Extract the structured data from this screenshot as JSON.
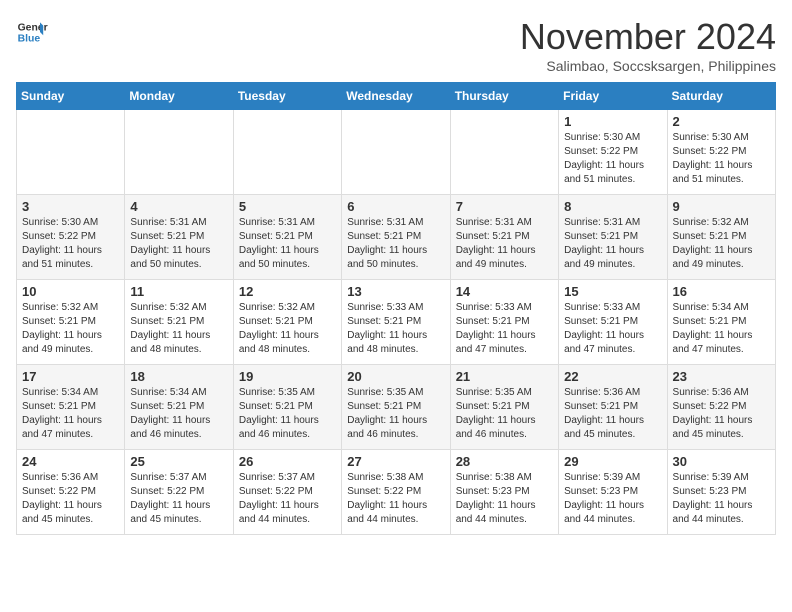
{
  "logo": {
    "line1": "General",
    "line2": "Blue"
  },
  "title": "November 2024",
  "subtitle": "Salimbao, Soccsksargen, Philippines",
  "weekdays": [
    "Sunday",
    "Monday",
    "Tuesday",
    "Wednesday",
    "Thursday",
    "Friday",
    "Saturday"
  ],
  "weeks": [
    [
      {
        "day": "",
        "info": ""
      },
      {
        "day": "",
        "info": ""
      },
      {
        "day": "",
        "info": ""
      },
      {
        "day": "",
        "info": ""
      },
      {
        "day": "",
        "info": ""
      },
      {
        "day": "1",
        "info": "Sunrise: 5:30 AM\nSunset: 5:22 PM\nDaylight: 11 hours and 51 minutes."
      },
      {
        "day": "2",
        "info": "Sunrise: 5:30 AM\nSunset: 5:22 PM\nDaylight: 11 hours and 51 minutes."
      }
    ],
    [
      {
        "day": "3",
        "info": "Sunrise: 5:30 AM\nSunset: 5:22 PM\nDaylight: 11 hours and 51 minutes."
      },
      {
        "day": "4",
        "info": "Sunrise: 5:31 AM\nSunset: 5:21 PM\nDaylight: 11 hours and 50 minutes."
      },
      {
        "day": "5",
        "info": "Sunrise: 5:31 AM\nSunset: 5:21 PM\nDaylight: 11 hours and 50 minutes."
      },
      {
        "day": "6",
        "info": "Sunrise: 5:31 AM\nSunset: 5:21 PM\nDaylight: 11 hours and 50 minutes."
      },
      {
        "day": "7",
        "info": "Sunrise: 5:31 AM\nSunset: 5:21 PM\nDaylight: 11 hours and 49 minutes."
      },
      {
        "day": "8",
        "info": "Sunrise: 5:31 AM\nSunset: 5:21 PM\nDaylight: 11 hours and 49 minutes."
      },
      {
        "day": "9",
        "info": "Sunrise: 5:32 AM\nSunset: 5:21 PM\nDaylight: 11 hours and 49 minutes."
      }
    ],
    [
      {
        "day": "10",
        "info": "Sunrise: 5:32 AM\nSunset: 5:21 PM\nDaylight: 11 hours and 49 minutes."
      },
      {
        "day": "11",
        "info": "Sunrise: 5:32 AM\nSunset: 5:21 PM\nDaylight: 11 hours and 48 minutes."
      },
      {
        "day": "12",
        "info": "Sunrise: 5:32 AM\nSunset: 5:21 PM\nDaylight: 11 hours and 48 minutes."
      },
      {
        "day": "13",
        "info": "Sunrise: 5:33 AM\nSunset: 5:21 PM\nDaylight: 11 hours and 48 minutes."
      },
      {
        "day": "14",
        "info": "Sunrise: 5:33 AM\nSunset: 5:21 PM\nDaylight: 11 hours and 47 minutes."
      },
      {
        "day": "15",
        "info": "Sunrise: 5:33 AM\nSunset: 5:21 PM\nDaylight: 11 hours and 47 minutes."
      },
      {
        "day": "16",
        "info": "Sunrise: 5:34 AM\nSunset: 5:21 PM\nDaylight: 11 hours and 47 minutes."
      }
    ],
    [
      {
        "day": "17",
        "info": "Sunrise: 5:34 AM\nSunset: 5:21 PM\nDaylight: 11 hours and 47 minutes."
      },
      {
        "day": "18",
        "info": "Sunrise: 5:34 AM\nSunset: 5:21 PM\nDaylight: 11 hours and 46 minutes."
      },
      {
        "day": "19",
        "info": "Sunrise: 5:35 AM\nSunset: 5:21 PM\nDaylight: 11 hours and 46 minutes."
      },
      {
        "day": "20",
        "info": "Sunrise: 5:35 AM\nSunset: 5:21 PM\nDaylight: 11 hours and 46 minutes."
      },
      {
        "day": "21",
        "info": "Sunrise: 5:35 AM\nSunset: 5:21 PM\nDaylight: 11 hours and 46 minutes."
      },
      {
        "day": "22",
        "info": "Sunrise: 5:36 AM\nSunset: 5:21 PM\nDaylight: 11 hours and 45 minutes."
      },
      {
        "day": "23",
        "info": "Sunrise: 5:36 AM\nSunset: 5:22 PM\nDaylight: 11 hours and 45 minutes."
      }
    ],
    [
      {
        "day": "24",
        "info": "Sunrise: 5:36 AM\nSunset: 5:22 PM\nDaylight: 11 hours and 45 minutes."
      },
      {
        "day": "25",
        "info": "Sunrise: 5:37 AM\nSunset: 5:22 PM\nDaylight: 11 hours and 45 minutes."
      },
      {
        "day": "26",
        "info": "Sunrise: 5:37 AM\nSunset: 5:22 PM\nDaylight: 11 hours and 44 minutes."
      },
      {
        "day": "27",
        "info": "Sunrise: 5:38 AM\nSunset: 5:22 PM\nDaylight: 11 hours and 44 minutes."
      },
      {
        "day": "28",
        "info": "Sunrise: 5:38 AM\nSunset: 5:23 PM\nDaylight: 11 hours and 44 minutes."
      },
      {
        "day": "29",
        "info": "Sunrise: 5:39 AM\nSunset: 5:23 PM\nDaylight: 11 hours and 44 minutes."
      },
      {
        "day": "30",
        "info": "Sunrise: 5:39 AM\nSunset: 5:23 PM\nDaylight: 11 hours and 44 minutes."
      }
    ]
  ]
}
